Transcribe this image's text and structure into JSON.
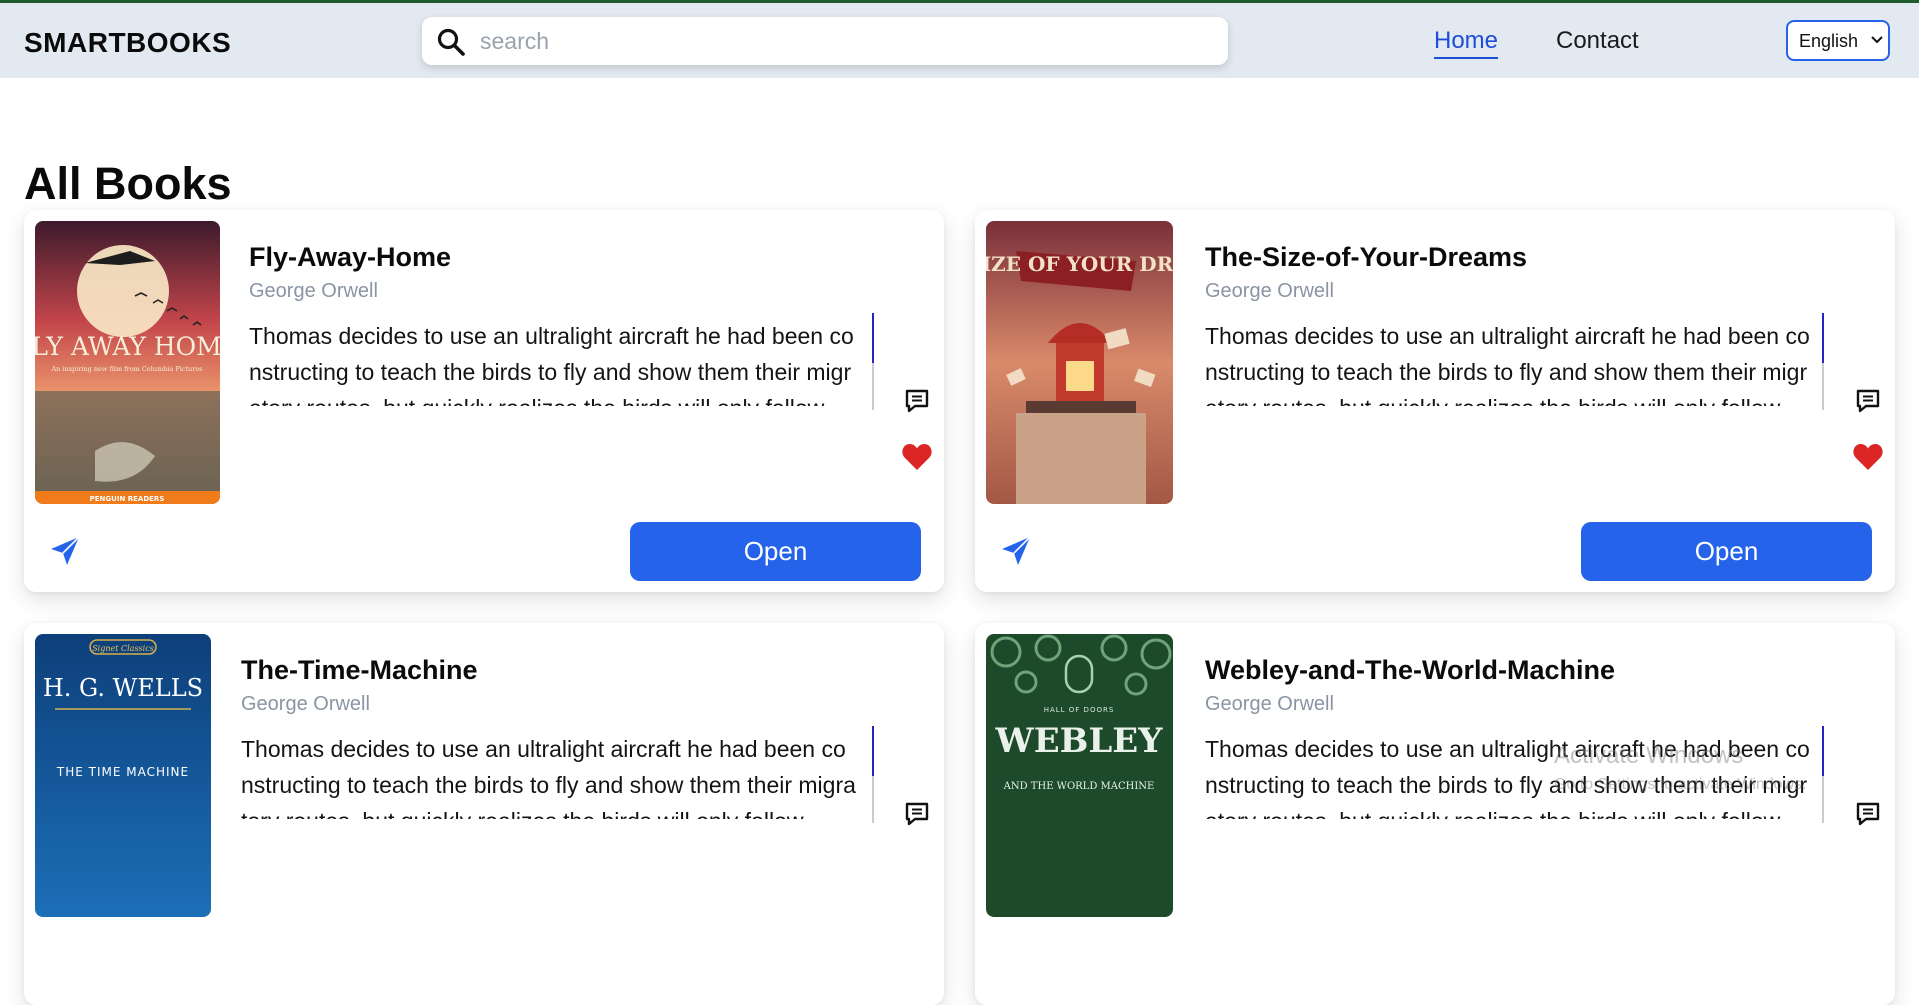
{
  "header": {
    "brand": "SMARTBOOKS",
    "search_placeholder": "search",
    "nav": {
      "home": "Home",
      "contact": "Contact"
    },
    "language": "English"
  },
  "page": {
    "heading": "All Books"
  },
  "books": [
    {
      "title": "Fly-Away-Home",
      "author": "George Orwell",
      "description": "Thomas decides to use an ultralight aircraft he had been constructing to teach the birds to fly and show them their migratory routes, but quickly realizes the birds will only follow",
      "open_label": "Open",
      "cover": {
        "title": "FLY AWAY HOME",
        "subtitle": "An inspiring new film from Columbia Pictures",
        "footer": "PENGUIN READERS"
      }
    },
    {
      "title": "The-Size-of-Your-Dreams",
      "author": "George Orwell",
      "description": "Thomas decides to use an ultralight aircraft he had been constructing to teach the birds to fly and show them their migratory routes, but quickly realizes the birds will only follow",
      "open_label": "Open",
      "cover": {
        "title": "THE SIZE OF YOUR DREAMS"
      }
    },
    {
      "title": "The-Time-Machine",
      "author": "George Orwell",
      "description": "Thomas decides to use an ultralight aircraft he had been constructing to teach the birds to fly and show them their migratory routes, but quickly realizes the birds will only follow",
      "open_label": "Open",
      "cover": {
        "badge": "Signet Classics",
        "author": "H. G. WELLS",
        "title": "THE TIME MACHINE"
      }
    },
    {
      "title": "Webley-and-The-World-Machine",
      "author": "George Orwell",
      "description": "Thomas decides to use an ultralight aircraft he had been constructing to teach the birds to fly and show them their migratory routes, but quickly realizes the birds will only follow",
      "open_label": "Open",
      "cover": {
        "top": "HALL OF DOORS",
        "title": "WEBLEY",
        "subtitle": "AND THE WORLD MACHINE"
      }
    }
  ],
  "watermark": {
    "line1": "Activate Windows",
    "line2": "Go to Settings to activate Windows."
  },
  "colors": {
    "accent": "#2563eb",
    "header_bg": "#e3e9f1",
    "heart": "#dc2626",
    "author": "#8a94a3"
  }
}
